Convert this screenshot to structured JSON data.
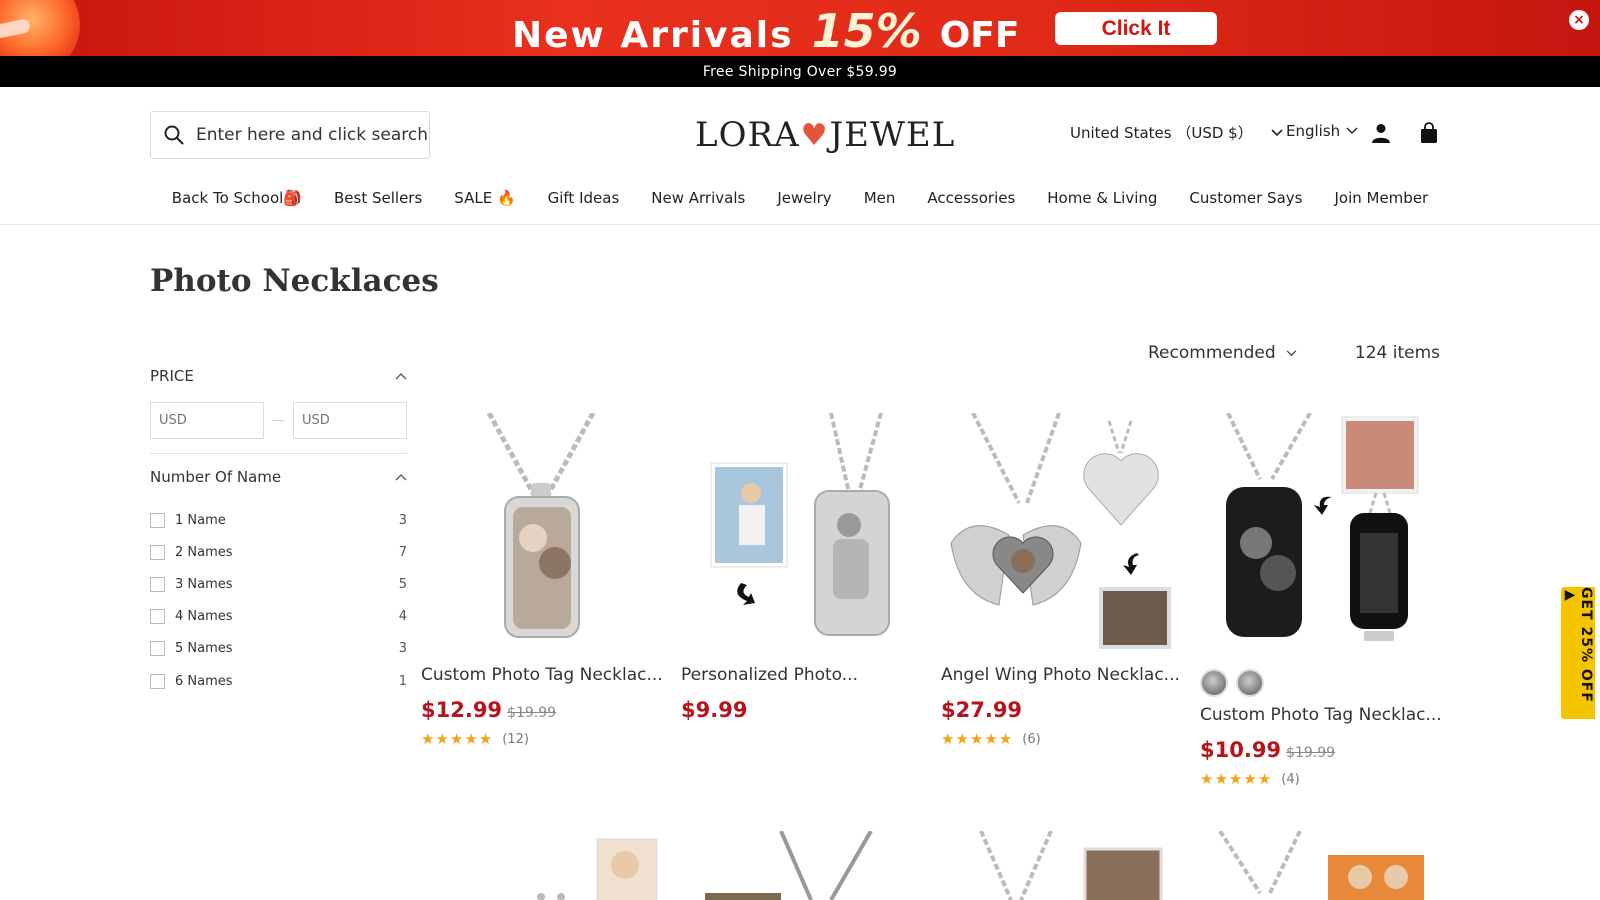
{
  "promo": {
    "text_left": "New Arrivals",
    "text_pct": "15%",
    "text_off": "OFF",
    "button_label": "Click It",
    "close_glyph": "×",
    "colors": {
      "background": "#d8200f",
      "button_text": "#d2160f"
    }
  },
  "shipping_bar": {
    "text": "Free Shipping Over $59.99"
  },
  "header": {
    "search_placeholder": "Enter here and click search",
    "search_icon": "search-icon",
    "logo": {
      "left": "LORA",
      "heart": "♥",
      "right": "JEWEL"
    },
    "currency_label": "United States （USD $）",
    "language_label": "English",
    "account_icon": "user-icon",
    "cart_icon": "shopping-bag-icon"
  },
  "nav": {
    "items": [
      {
        "label": "Back To School🎒"
      },
      {
        "label": "Best Sellers"
      },
      {
        "label": "SALE 🔥"
      },
      {
        "label": "Gift Ideas"
      },
      {
        "label": "New Arrivals"
      },
      {
        "label": "Jewelry"
      },
      {
        "label": "Men"
      },
      {
        "label": "Accessories"
      },
      {
        "label": "Home & Living"
      },
      {
        "label": "Customer Says"
      },
      {
        "label": "Join Member"
      }
    ]
  },
  "page": {
    "title": "Photo Necklaces"
  },
  "filters": {
    "price": {
      "title": "PRICE",
      "min_placeholder": "USD",
      "max_placeholder": "USD",
      "separator": "—"
    },
    "number_of_name": {
      "title": "Number Of Name",
      "options": [
        {
          "label": "1 Name",
          "count": "3"
        },
        {
          "label": "2 Names",
          "count": "7"
        },
        {
          "label": "3 Names",
          "count": "5"
        },
        {
          "label": "4 Names",
          "count": "4"
        },
        {
          "label": "5 Names",
          "count": "3"
        },
        {
          "label": "6 Names",
          "count": "1"
        }
      ]
    }
  },
  "sort": {
    "selected": "Recommended",
    "items_count": "124 items"
  },
  "products": [
    {
      "name": "Custom Photo Tag Necklac...",
      "price": "$12.99",
      "was": "$19.99",
      "stars": "★★★★★",
      "reviews": "(12)"
    },
    {
      "name": "Personalized Photo...",
      "price": "$9.99",
      "was": "",
      "stars": "",
      "reviews": ""
    },
    {
      "name": "Angel Wing Photo Necklac...",
      "price": "$27.99",
      "was": "",
      "stars": "★★★★★",
      "reviews": "(6)"
    },
    {
      "name": "Custom Photo Tag Necklac...",
      "price": "$10.99",
      "was": "$19.99",
      "stars": "★★★★★",
      "reviews": "(4)"
    }
  ],
  "side_tab": {
    "text": "GET 25% OFF ▶"
  },
  "colors": {
    "price_red": "#b8121b",
    "star_gold": "#f1a415",
    "side_tab": "#f5c400"
  }
}
